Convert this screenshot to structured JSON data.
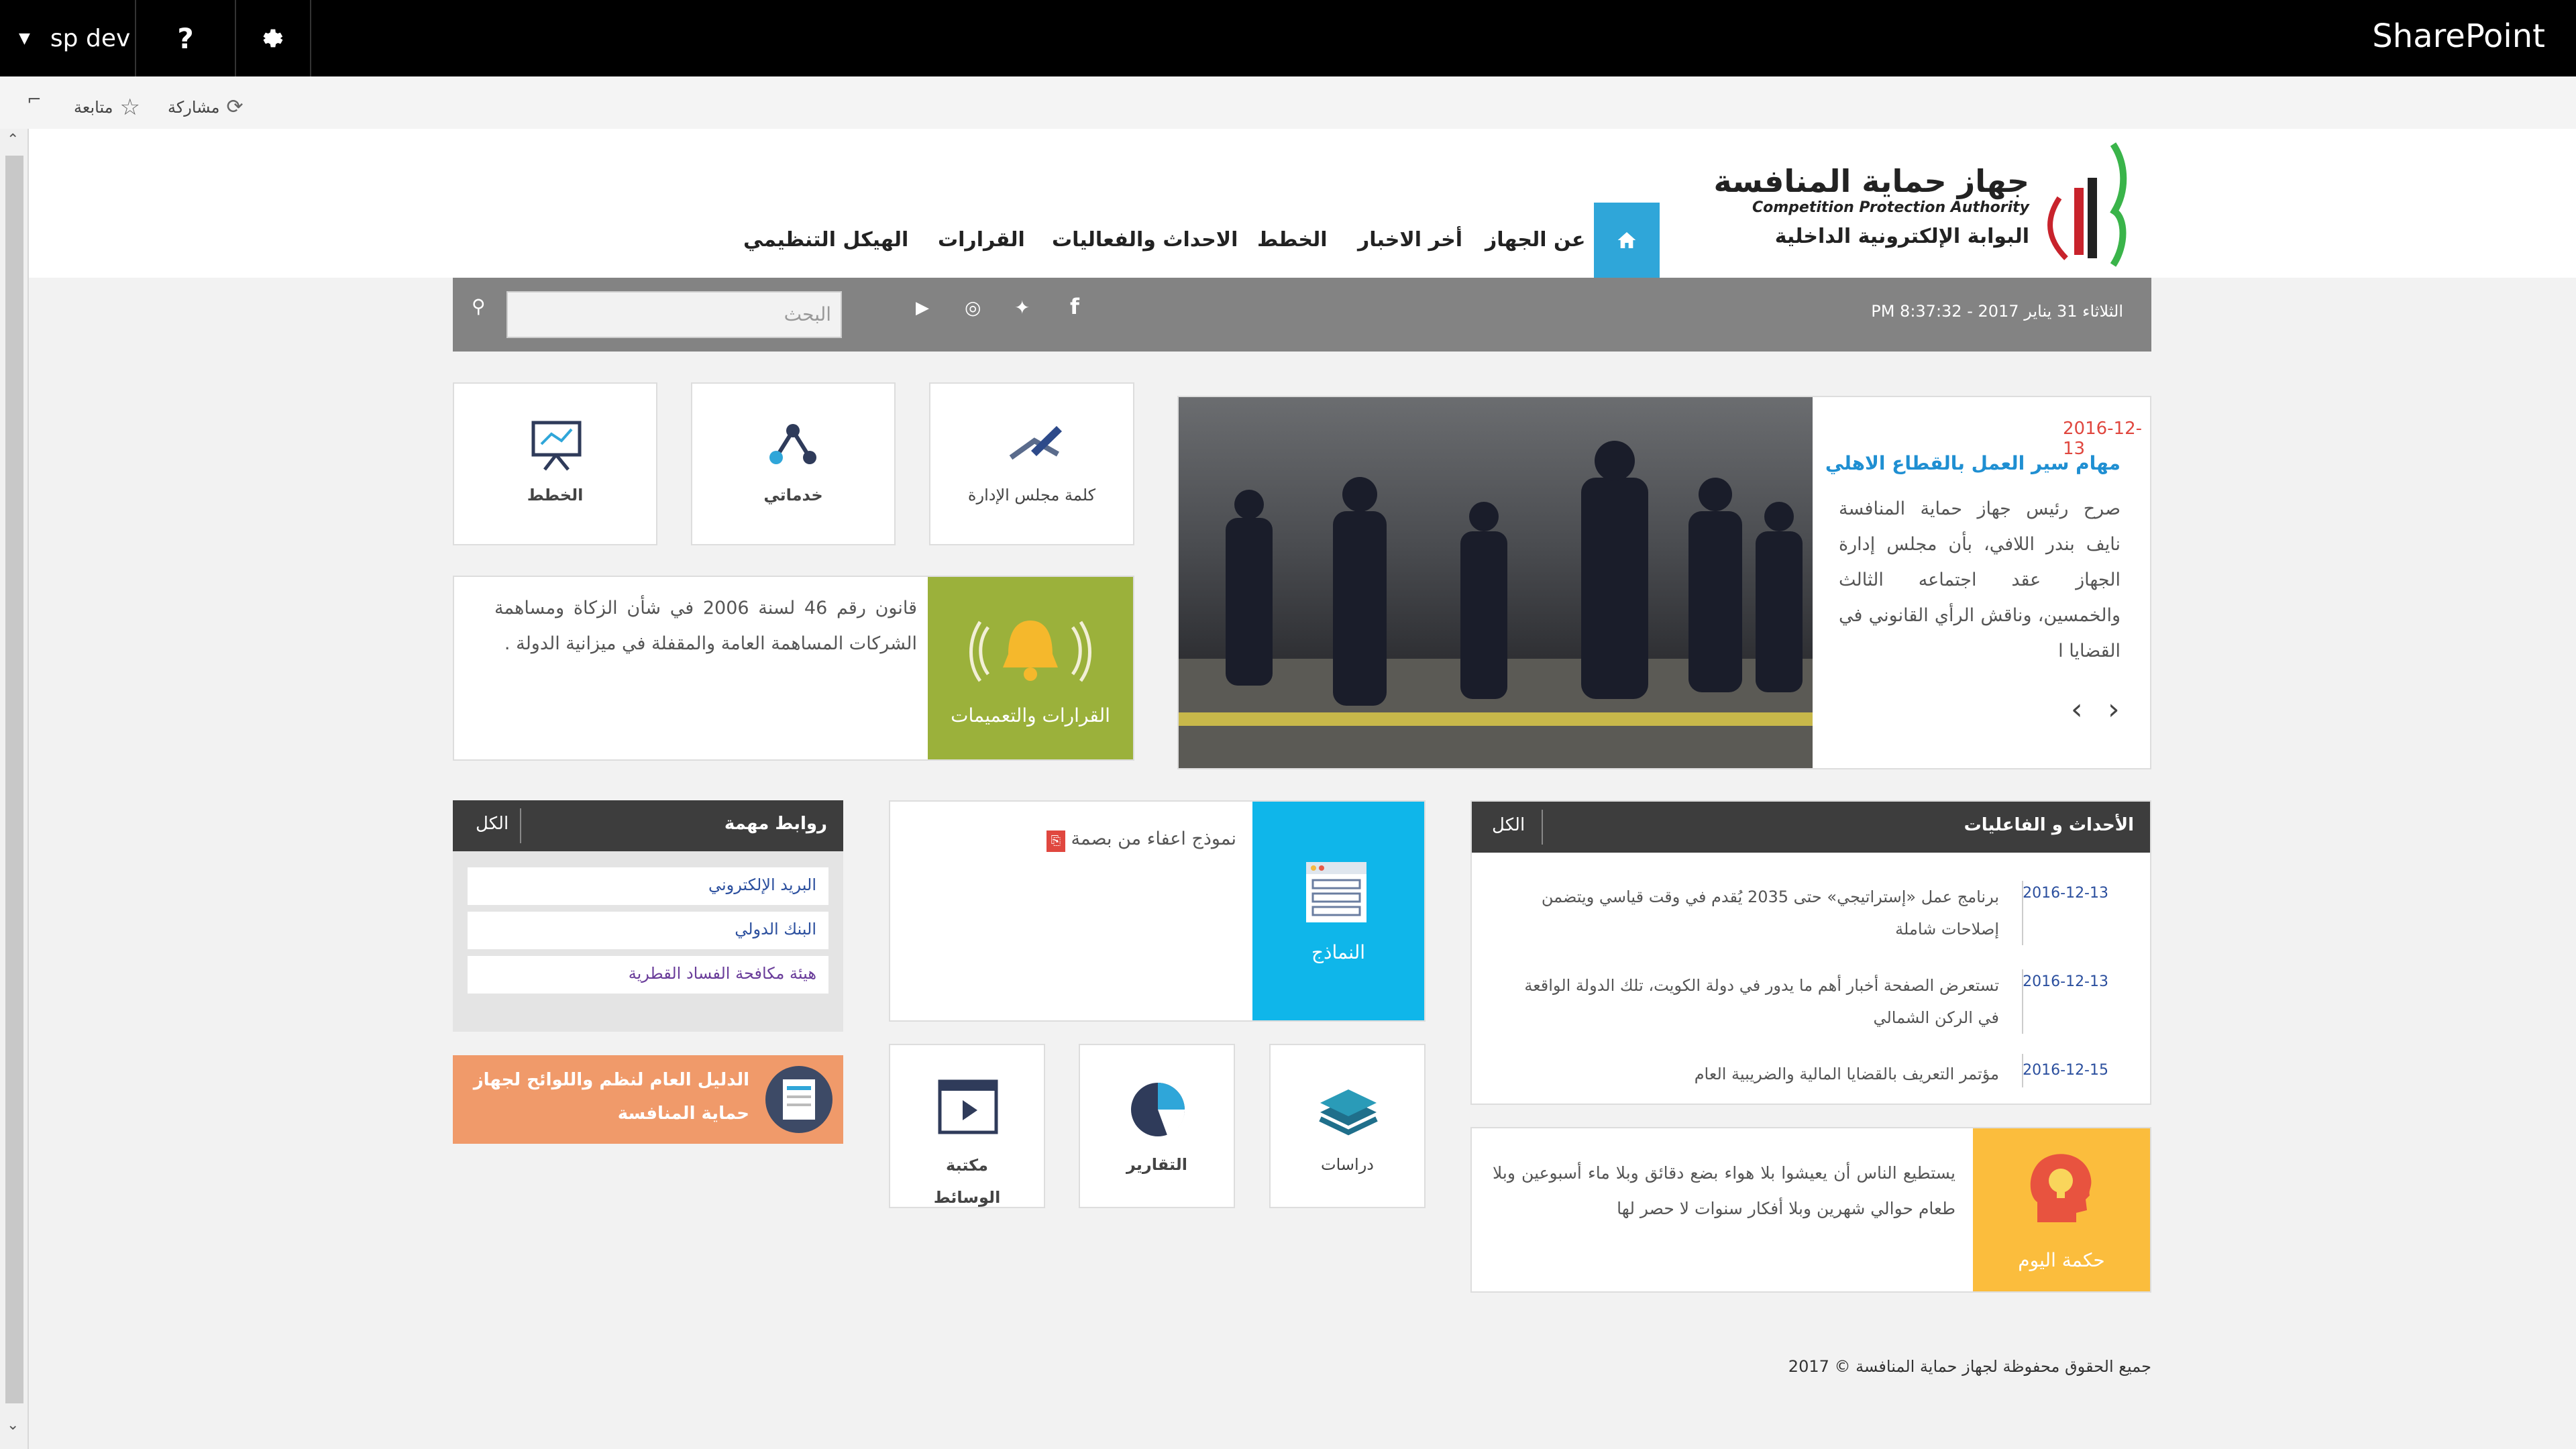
{
  "suite": {
    "site_name": "sp dev",
    "help": "?",
    "brand": "SharePoint"
  },
  "ribbon": {
    "share": "مشاركة",
    "follow": "متابعة"
  },
  "logo": {
    "arabic_name": "جهاز حماية المنافسة",
    "english_name": "Competition Protection Authority",
    "portal": "البوابة الإلكترونية الداخلية"
  },
  "nav": {
    "items": [
      "عن الجهاز",
      "أخر الاخبار",
      "الخطط",
      "الاحداث والفعاليات",
      "القرارات",
      "الهيكل التنظيمي"
    ]
  },
  "infobar": {
    "datetime": "الثلاثاء 31 يناير 2017 - 8:37:32 PM",
    "search_placeholder": "البحث"
  },
  "news": {
    "date": "2016-12-13",
    "title": "مهام سير العمل بالقطاع الاهلي",
    "body": "صرح رئيس جهاز حماية المنافسة نايف بندر اللافي، بأن مجلس إدارة الجهاز عقد اجتماعه الثالث والخمسين، وناقش الرأي القانوني في القضايا ا"
  },
  "tiles": {
    "board_word": "كلمة مجلس الإدارة",
    "services": "خدماتي",
    "plans": "الخطط"
  },
  "decisions": {
    "label": "القرارات والتعميمات",
    "text": "قانون رقم 46 لسنة 2006 في شأن الزكاة ومساهمة الشركات المساهمة العامة والمقفلة في ميزانية الدولة ."
  },
  "events": {
    "title": "الأحداث و الفاعليات",
    "all": "الكل",
    "items": [
      {
        "date": "2016-12-13",
        "text": "برنامج عمل «إستراتيجي» حتى 2035 يُقدم في وقت قياسي ويتضمن إصلاحات شاملة"
      },
      {
        "date": "2016-12-13",
        "text": "تستعرض الصفحة أخبار أهم ما يدور في دولة الكويت، تلك الدولة الواقعة في الركن الشمالي"
      },
      {
        "date": "2016-12-15",
        "text": "مؤتمر التعريف بالقضايا المالية والضريبية العام"
      }
    ]
  },
  "forms": {
    "label": "النماذج",
    "item": "نموذج اعفاء من بصمة"
  },
  "media": {
    "studies": "دراسات",
    "reports": "التقارير",
    "library": "مكتبة الوسائط"
  },
  "links": {
    "title": "روابط مهمة",
    "all": "الكل",
    "items": [
      "البريد الإلكتروني",
      "البنك الدولي",
      "هيئة مكافحة الفساد القطرية"
    ]
  },
  "guide": {
    "text": "الدليل العام لنظم واللوائح لجهاز حماية المنافسة"
  },
  "wisdom": {
    "label": "حكمة اليوم",
    "text": "يستطيع الناس أن يعيشوا بلا هواء بضع دقائق وبلا ماء أسبوعين وبلا طعام حوالي شهرين وبلا أفكار سنوات لا حصر لها"
  },
  "footer": {
    "copyright": "جميع الحقوق محفوظة لجهاز حماية المنافسة © 2017"
  },
  "colors": {
    "nav_active": "#2fa6d9",
    "green_tile": "#9bb13b",
    "blue_tile": "#0fb6ea",
    "orange_tile": "#f09a6a",
    "yellow_tile": "#fbbd3d",
    "date_red": "#e0473f",
    "title_blue": "#1f8fd2"
  }
}
